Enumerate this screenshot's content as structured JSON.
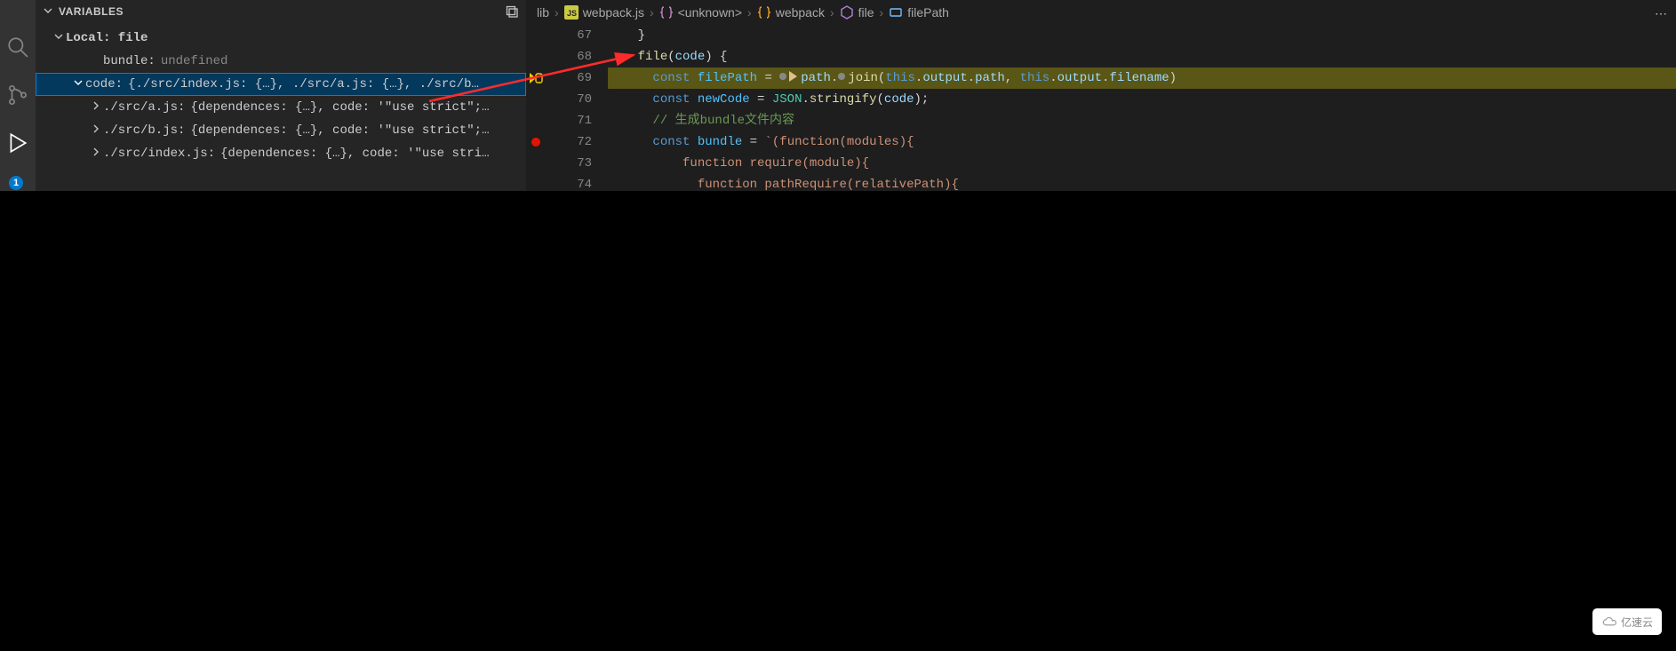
{
  "panel": {
    "title": "VARIABLES",
    "scope": "Local: file",
    "rows": {
      "bundle": {
        "label": "bundle:",
        "value": "undefined"
      },
      "code": {
        "label": "code:",
        "value": "{./src/index.js: {…}, ./src/a.js: {…}, ./src/b…"
      },
      "a": {
        "label": "./src/a.js:",
        "value": "{dependences: {…}, code: '\"use strict\";…"
      },
      "b": {
        "label": "./src/b.js:",
        "value": "{dependences: {…}, code: '\"use strict\";…"
      },
      "index": {
        "label": "./src/index.js:",
        "value": "{dependences: {…}, code: '\"use stri…"
      }
    },
    "badge": "1"
  },
  "breadcrumbs": {
    "items": [
      {
        "text": "lib"
      },
      {
        "text": "webpack.js",
        "icon": "js"
      },
      {
        "text": "<unknown>",
        "icon": "namespace"
      },
      {
        "text": "webpack",
        "icon": "class"
      },
      {
        "text": "file",
        "icon": "method"
      },
      {
        "text": "filePath",
        "icon": "field"
      }
    ]
  },
  "lines": {
    "nums": [
      "67",
      "68",
      "69",
      "70",
      "71",
      "72",
      "73",
      "74"
    ]
  },
  "code": {
    "l67": "    }",
    "l68_a": "file",
    "l68_b": "(",
    "l68_c": "code",
    "l68_d": ") {",
    "l69_kw": "const ",
    "l69_v": "filePath",
    "l69_eq": " = ",
    "l69_path": "path",
    "l69_dot1": ".",
    "l69_join": "join",
    "l69_op": "(",
    "l69_this1": "this",
    "l69_d1": ".",
    "l69_out1": "output",
    "l69_d2": ".",
    "l69_p1": "path",
    "l69_comma": ", ",
    "l69_this2": "this",
    "l69_d3": ".",
    "l69_out2": "output",
    "l69_d4": ".",
    "l69_fn": "filename",
    "l69_cp": ")",
    "l70_kw": "const ",
    "l70_v": "newCode",
    "l70_eq": " = ",
    "l70_JSON": "JSON",
    "l70_d": ".",
    "l70_strf": "stringify",
    "l70_op": "(",
    "l70_arg": "code",
    "l70_cp": ");",
    "l71_cmt": "// 生成bundle文件内容",
    "l72_kw": "const ",
    "l72_v": "bundle",
    "l72_eq": " = ",
    "l72_str": "`(function(modules){",
    "l73_str": "  function require(module){",
    "l74_str": "    function pathRequire(relativePath){"
  },
  "watermark": "亿速云"
}
